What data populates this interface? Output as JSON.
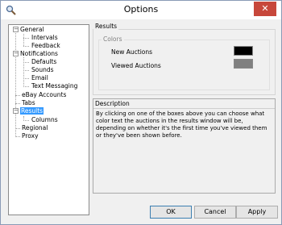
{
  "window": {
    "title": "Options"
  },
  "tree": {
    "items": [
      {
        "label": "General"
      },
      {
        "label": "Intervals"
      },
      {
        "label": "Feedback"
      },
      {
        "label": "Notifications"
      },
      {
        "label": "Defaults"
      },
      {
        "label": "Sounds"
      },
      {
        "label": "Email"
      },
      {
        "label": "Text Messaging"
      },
      {
        "label": "eBay Accounts"
      },
      {
        "label": "Tabs"
      },
      {
        "label": "Results"
      },
      {
        "label": "Columns"
      },
      {
        "label": "Regional"
      },
      {
        "label": "Proxy"
      }
    ],
    "selected": "Results"
  },
  "results": {
    "group_title": "Results",
    "colors_title": "Colors",
    "new_auctions_label": "New Auctions",
    "viewed_auctions_label": "Viewed Auctions",
    "new_auctions_color": "#000000",
    "viewed_auctions_color": "#808080"
  },
  "description": {
    "title": "Description",
    "text": "By clicking on one of the boxes above you can choose what color text the auctions in the results window will be, depending on whether it's the first time you've viewed them or they've been shown before."
  },
  "buttons": {
    "ok": "OK",
    "cancel": "Cancel",
    "apply": "Apply"
  },
  "icons": {
    "app": "search-magnifier-icon",
    "close": "close-icon"
  }
}
